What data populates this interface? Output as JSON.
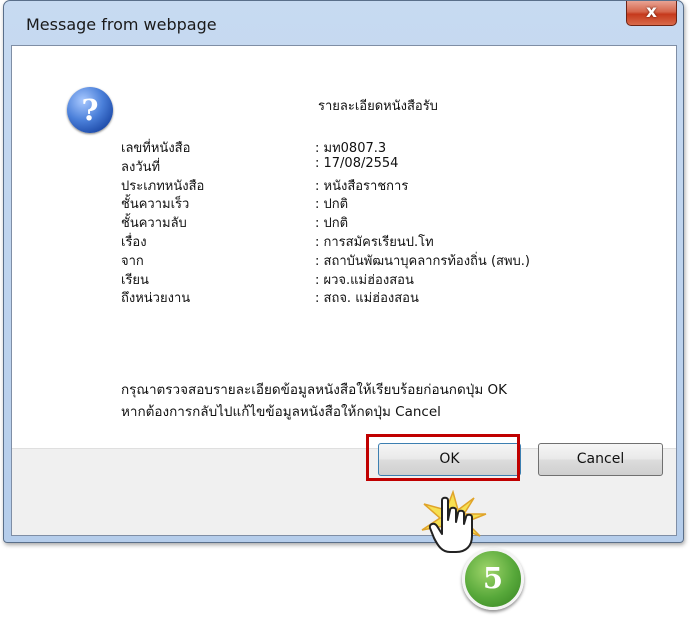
{
  "window": {
    "title": "Message from webpage",
    "close_label": "x"
  },
  "dialog": {
    "icon": "question-icon",
    "heading": "รายละเอียดหนังสือรับ",
    "fields": [
      {
        "label": "เลขที่หนังสือ",
        "value": ": มท0807.3"
      },
      {
        "label": "ลงวันที่",
        "value": ": 17/08/2554"
      },
      {
        "label": "ประเภทหนังสือ",
        "value": ": หนังสือราชการ"
      },
      {
        "label": "ชั้นความเร็ว",
        "value": ": ปกติ"
      },
      {
        "label": "ชั้นความลับ",
        "value": ": ปกติ"
      },
      {
        "label": "เรื่อง",
        "value": ": การสมัครเรียนป.โท"
      },
      {
        "label": "จาก",
        "value": ": สถาบันพัฒนาบุคลากรท้องถิ่น (สพบ.)"
      },
      {
        "label": "เรียน",
        "value": ": ผวจ.แม่ฮ่องสอน"
      },
      {
        "label": "ถึงหน่วยงาน",
        "value": ": สถจ. แม่ฮ่องสอน"
      }
    ],
    "note_line1": "กรุณาตรวจสอบรายละเอียดข้อมูลหนังสือให้เรียบร้อยก่อนกดปุ่ม OK",
    "note_line2": "หากต้องการกลับไปแก้ไขข้อมูลหนังสือให้กดปุ่ม Cancel"
  },
  "buttons": {
    "ok_label": "OK",
    "cancel_label": "Cancel"
  },
  "annotation": {
    "step_number": "5",
    "highlight_color": "#c00000",
    "badge_color": "#57a83a"
  }
}
